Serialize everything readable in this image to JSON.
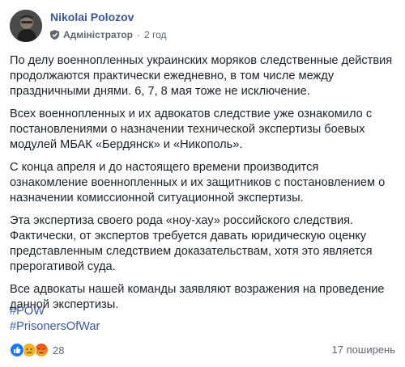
{
  "author": {
    "name": "Nikolai Polozov",
    "role": "Адміністратор",
    "time": "2 год"
  },
  "post": {
    "paragraphs": [
      "По делу военнопленных украинских моряков следственные действия продолжаются практически ежедневно, в том числе между праздничными днями. 6, 7, 8 мая тоже не исключение.",
      "Всех военнопленных и их адвокатов следствие уже ознакомило с постановлениями о назначении технической экспертизы боевых модулей МБАК «Бердянск» и «Никополь».",
      "С конца апреля и до настоящего времени производится ознакомление военнопленных и их защитников с постановлением о назначении комиссионной ситуационной экспертизы.",
      "Эта экспертиза своего рода «ноу-хау» российского следствия. Фактически, от экспертов требуется давать юридическую оценку представленным следствием доказательствам, хотя это является прерогативой суда.",
      "Все адвокаты нашей команды заявляют возражения на проведение данной экспертизы."
    ],
    "hashtags": [
      "#POW",
      "#PrisonersOfWar"
    ]
  },
  "footer": {
    "reaction_count": "28",
    "reaction_icons": [
      "like-icon",
      "sad-icon",
      "angry-icon"
    ],
    "shares": "17 поширень"
  },
  "colors": {
    "link": "#385898",
    "text": "#1d2129",
    "meta": "#616770",
    "like": "#1877f2",
    "sad": "#f7b125",
    "angry": "#e9710f"
  }
}
